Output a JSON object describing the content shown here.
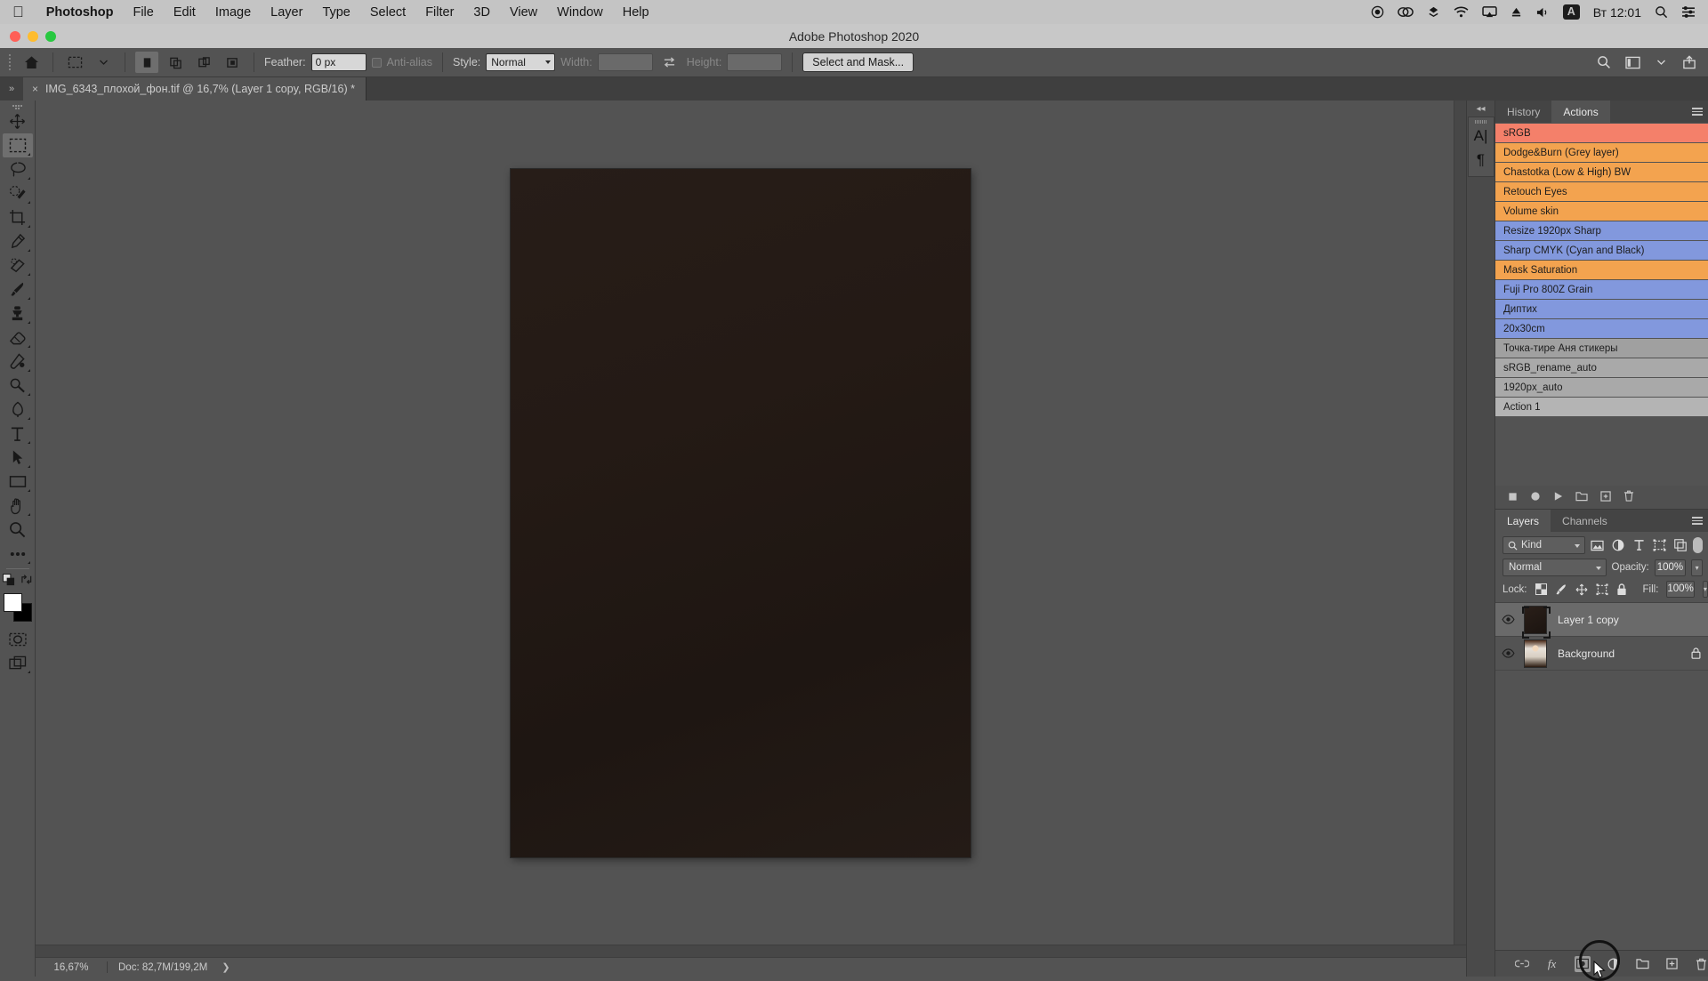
{
  "macos": {
    "apple_menu": "apple-logo",
    "menus": [
      {
        "label": "Photoshop",
        "bold": true
      },
      {
        "label": "File",
        "bold": false
      },
      {
        "label": "Edit",
        "bold": false
      },
      {
        "label": "Image",
        "bold": false
      },
      {
        "label": "Layer",
        "bold": false
      },
      {
        "label": "Type",
        "bold": false
      },
      {
        "label": "Select",
        "bold": false
      },
      {
        "label": "Filter",
        "bold": false
      },
      {
        "label": "3D",
        "bold": false
      },
      {
        "label": "View",
        "bold": false
      },
      {
        "label": "Window",
        "bold": false
      },
      {
        "label": "Help",
        "bold": false
      }
    ],
    "status_icons": [
      "record-icon",
      "creative-cloud-icon",
      "dropbox-icon",
      "wifi-icon",
      "airplay-icon",
      "eject-icon",
      "volume-icon"
    ],
    "keyboard_layout": "A",
    "clock": "Вт 12:01",
    "spotlight": "search-icon",
    "control_center": "control-center-icon"
  },
  "window": {
    "title": "Adobe Photoshop 2020"
  },
  "options_bar": {
    "home_icon": "home-icon",
    "tool_preset": "marquee-tool-preset",
    "selection_modes": [
      "new-selection",
      "add-to-selection",
      "subtract-from-selection",
      "intersect-selection"
    ],
    "feather_label": "Feather:",
    "feather_value": "0 px",
    "antialias_label": "Anti-alias",
    "antialias_checked": false,
    "style_label": "Style:",
    "style_value": "Normal",
    "width_label": "Width:",
    "width_value": "",
    "swap_icon": "swap-dimensions-icon",
    "height_label": "Height:",
    "height_value": "",
    "select_and_mask": "Select and Mask...",
    "right_icons": [
      "search-icon",
      "workspace-icon",
      "chevron-down-icon",
      "share-icon"
    ]
  },
  "document": {
    "tab_title": "IMG_6343_плохой_фон.tif @ 16,7% (Layer 1 copy, RGB/16) *",
    "close_icon": "close-icon",
    "collapse_icon": "collapse-panels-icon"
  },
  "toolbar": {
    "tools": [
      {
        "name": "move-tool",
        "selected": false,
        "submenu": false
      },
      {
        "name": "rectangular-marquee-tool",
        "selected": true,
        "submenu": true
      },
      {
        "name": "lasso-tool",
        "selected": false,
        "submenu": true
      },
      {
        "name": "quick-selection-tool",
        "selected": false,
        "submenu": true
      },
      {
        "name": "crop-tool",
        "selected": false,
        "submenu": true
      },
      {
        "name": "eyedropper-tool",
        "selected": false,
        "submenu": true
      },
      {
        "name": "spot-healing-brush-tool",
        "selected": false,
        "submenu": true
      },
      {
        "name": "brush-tool",
        "selected": false,
        "submenu": true
      },
      {
        "name": "clone-stamp-tool",
        "selected": false,
        "submenu": true
      },
      {
        "name": "eraser-tool",
        "selected": false,
        "submenu": true
      },
      {
        "name": "gradient-tool",
        "selected": false,
        "submenu": true
      },
      {
        "name": "dodge-tool",
        "selected": false,
        "submenu": true
      },
      {
        "name": "pen-tool",
        "selected": false,
        "submenu": true
      },
      {
        "name": "type-tool",
        "selected": false,
        "submenu": true
      },
      {
        "name": "path-selection-tool",
        "selected": false,
        "submenu": true
      },
      {
        "name": "rectangle-tool",
        "selected": false,
        "submenu": true
      },
      {
        "name": "hand-tool",
        "selected": false,
        "submenu": true
      },
      {
        "name": "zoom-tool",
        "selected": false,
        "submenu": false
      },
      {
        "name": "edit-toolbar-tool",
        "selected": false,
        "submenu": false
      }
    ],
    "foreground_color": "#ffffff",
    "background_color": "#000000",
    "quick_mask_icon": "quick-mask-icon",
    "screen_mode_icon": "screen-mode-icon"
  },
  "canvas": {
    "image_color": "#241a15",
    "zoom": "16,67%",
    "doc_size": "Doc: 82,7M/199,2M",
    "status_arrow": "❯"
  },
  "mini_dock": {
    "collapse_icon": "collapse-to-icons-icon",
    "icons": [
      {
        "name": "character-panel-icon",
        "glyph": "A|"
      },
      {
        "name": "paragraph-panel-icon",
        "glyph": "¶"
      }
    ]
  },
  "actions_panel": {
    "tabs": [
      {
        "label": "History",
        "active": false
      },
      {
        "label": "Actions",
        "active": true
      }
    ],
    "menu_icon": "panel-menu-icon",
    "items": [
      {
        "label": "sRGB",
        "color": "#f4806a",
        "selected": true
      },
      {
        "label": "Dodge&Burn (Grey layer)",
        "color": "#f3a34f",
        "selected": false
      },
      {
        "label": "Chastotka (Low & High) BW",
        "color": "#f3a34f",
        "selected": false
      },
      {
        "label": "Retouch Eyes",
        "color": "#f3a34f",
        "selected": false
      },
      {
        "label": "Volume skin",
        "color": "#f3a34f",
        "selected": false
      },
      {
        "label": "Resize 1920px Sharp",
        "color": "#8298dd",
        "selected": false
      },
      {
        "label": "Sharp CMYK (Cyan and Black)",
        "color": "#8298dd",
        "selected": false
      },
      {
        "label": "Mask Saturation",
        "color": "#f3a34f",
        "selected": false
      },
      {
        "label": "Fuji Pro 800Z Grain",
        "color": "#8298dd",
        "selected": false
      },
      {
        "label": "Диптих",
        "color": "#8298dd",
        "selected": false
      },
      {
        "label": "20x30cm",
        "color": "#8298dd",
        "selected": false
      },
      {
        "label": "Точка-тире Аня стикеры",
        "color": "#a0a0a0",
        "selected": false
      },
      {
        "label": "sRGB_rename_auto",
        "color": "#a9a9a9",
        "selected": false
      },
      {
        "label": "1920px_auto",
        "color": "#a9a9a9",
        "selected": false
      },
      {
        "label": "Action 1",
        "color": "#b4b4b4",
        "selected": false
      }
    ],
    "bottom_icons": [
      "stop-icon",
      "record-icon",
      "play-icon",
      "new-set-icon",
      "new-action-icon",
      "delete-icon"
    ]
  },
  "layers_panel": {
    "tabs": [
      {
        "label": "Layers",
        "active": true
      },
      {
        "label": "Channels",
        "active": false
      }
    ],
    "menu_icon": "panel-menu-icon",
    "filter": {
      "search_icon": "search-icon",
      "kind_label": "Kind",
      "filter_icons": [
        "pixel-filter-icon",
        "adjustment-filter-icon",
        "type-filter-icon",
        "shape-filter-icon",
        "smart-object-filter-icon"
      ],
      "toggle_icon": "filter-toggle-icon"
    },
    "blend_mode": "Normal",
    "opacity_label": "Opacity:",
    "opacity_value": "100%",
    "lock_label": "Lock:",
    "lock_icons": [
      "lock-transparent-pixels-icon",
      "lock-image-pixels-icon",
      "lock-position-icon",
      "lock-artboard-icon",
      "lock-all-icon"
    ],
    "fill_label": "Fill:",
    "fill_value": "100%",
    "layers": [
      {
        "name": "Layer 1 copy",
        "visible": true,
        "selected": true,
        "locked": false,
        "thumb": "dark-image-thumbnail"
      },
      {
        "name": "Background",
        "visible": true,
        "selected": false,
        "locked": true,
        "thumb": "portrait-thumbnail"
      }
    ],
    "bottom_icons": [
      {
        "name": "link-layers-icon",
        "highlighted": false
      },
      {
        "name": "layer-style-icon",
        "highlighted": false
      },
      {
        "name": "add-layer-mask-icon",
        "highlighted": true
      },
      {
        "name": "new-adjustment-layer-icon",
        "highlighted": false
      },
      {
        "name": "new-group-icon",
        "highlighted": false
      },
      {
        "name": "new-layer-icon",
        "highlighted": false
      },
      {
        "name": "delete-layer-icon",
        "highlighted": false
      }
    ]
  }
}
